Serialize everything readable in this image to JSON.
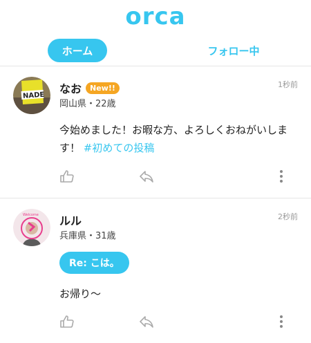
{
  "app": {
    "logo_text": "orca"
  },
  "tabs": {
    "home": "ホーム",
    "following": "フォロー中"
  },
  "posts": [
    {
      "name": "なお",
      "badge": "New!!",
      "meta": "岡山県・22歳",
      "time": "1秒前",
      "body": "今始めました！お暇な方、よろしくおねがいします！",
      "hashtag": "#初めての投稿"
    },
    {
      "name": "ルル",
      "meta": "兵庫県・31歳",
      "time": "2秒前",
      "reply_label": "Re: こは。",
      "body": "お帰り〜"
    }
  ],
  "icons": {
    "like": "thumbs-up-icon",
    "reply": "reply-arrow-icon",
    "more": "more-vertical-icon"
  },
  "colors": {
    "accent": "#37c6ef",
    "badge": "#f5a623"
  }
}
